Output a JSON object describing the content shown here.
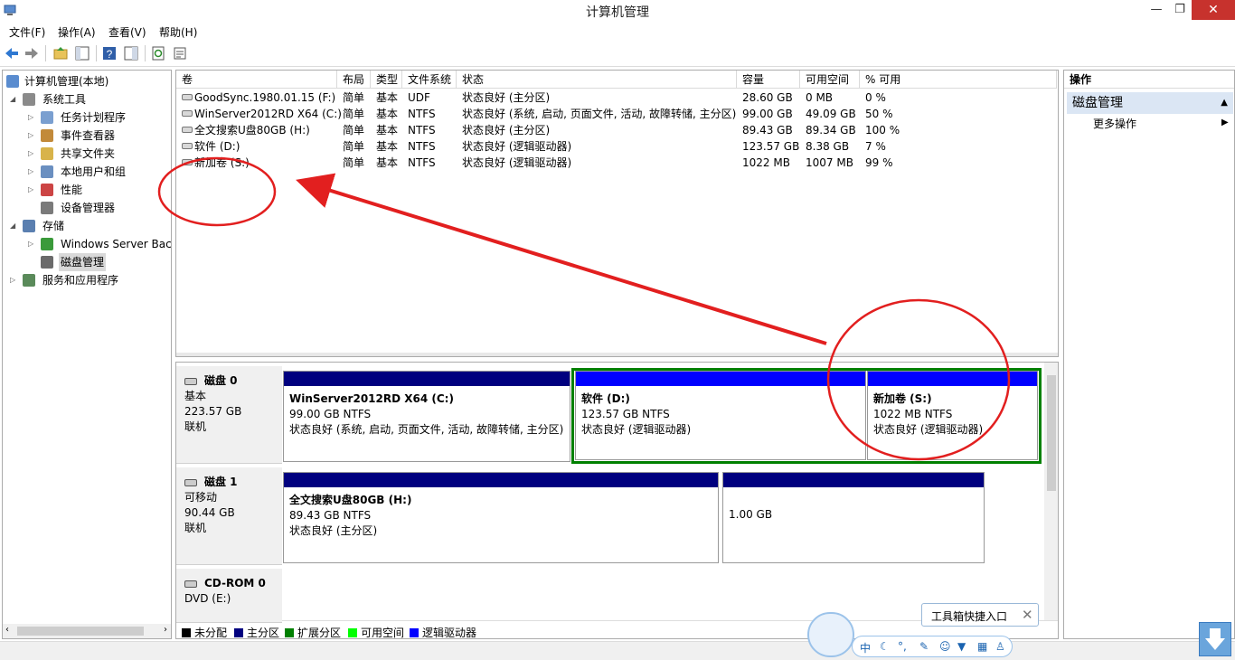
{
  "window": {
    "title": "计算机管理"
  },
  "menu": [
    "文件(F)",
    "操作(A)",
    "查看(V)",
    "帮助(H)"
  ],
  "toolbar_icons": [
    "back-arrow-icon",
    "forward-arrow-icon",
    "up-folder-icon",
    "show-hide-tree-icon",
    "help-icon",
    "properties-icon",
    "refresh-icon",
    "export-icon"
  ],
  "tree": {
    "items": [
      {
        "label": "计算机管理(本地)",
        "level": 0,
        "expander": "",
        "icon": "computer-management-icon"
      },
      {
        "label": "系统工具",
        "level": 1,
        "expander": "◢",
        "icon": "tools-icon"
      },
      {
        "label": "任务计划程序",
        "level": 2,
        "expander": "▷",
        "icon": "clock-icon"
      },
      {
        "label": "事件查看器",
        "level": 2,
        "expander": "▷",
        "icon": "event-viewer-icon"
      },
      {
        "label": "共享文件夹",
        "level": 2,
        "expander": "▷",
        "icon": "shared-folder-icon"
      },
      {
        "label": "本地用户和组",
        "level": 2,
        "expander": "▷",
        "icon": "users-icon"
      },
      {
        "label": "性能",
        "level": 2,
        "expander": "▷",
        "icon": "performance-icon"
      },
      {
        "label": "设备管理器",
        "level": 2,
        "expander": "",
        "icon": "device-manager-icon"
      },
      {
        "label": "存储",
        "level": 1,
        "expander": "◢",
        "icon": "storage-icon"
      },
      {
        "label": "Windows Server Back",
        "level": 2,
        "expander": "▷",
        "icon": "backup-icon"
      },
      {
        "label": "磁盘管理",
        "level": 2,
        "expander": "",
        "icon": "disk-management-icon",
        "selected": true
      },
      {
        "label": "服务和应用程序",
        "level": 1,
        "expander": "▷",
        "icon": "services-icon"
      }
    ]
  },
  "volume_table": {
    "columns": [
      "卷",
      "布局",
      "类型",
      "文件系统",
      "状态",
      "容量",
      "可用空间",
      "% 可用"
    ],
    "rows": [
      [
        "GoodSync.1980.01.15 (F:)",
        "简单",
        "基本",
        "UDF",
        "状态良好 (主分区)",
        "28.60 GB",
        "0 MB",
        "0 %"
      ],
      [
        "WinServer2012RD X64 (C:)",
        "简单",
        "基本",
        "NTFS",
        "状态良好 (系统, 启动, 页面文件, 活动, 故障转储, 主分区)",
        "99.00 GB",
        "49.09 GB",
        "50 %"
      ],
      [
        "全文搜索U盘80GB (H:)",
        "简单",
        "基本",
        "NTFS",
        "状态良好 (主分区)",
        "89.43 GB",
        "89.34 GB",
        "100 %"
      ],
      [
        "软件 (D:)",
        "简单",
        "基本",
        "NTFS",
        "状态良好 (逻辑驱动器)",
        "123.57 GB",
        "8.38 GB",
        "7 %"
      ],
      [
        "新加卷 (S:)",
        "简单",
        "基本",
        "NTFS",
        "状态良好 (逻辑驱动器)",
        "1022 MB",
        "1007 MB",
        "99 %"
      ]
    ]
  },
  "disks": [
    {
      "name": "磁盘 0",
      "type": "基本",
      "size": "223.57 GB",
      "status": "联机",
      "partitions": [
        {
          "name": "WinServer2012RD X64  (C:)",
          "size": "99.00 GB NTFS",
          "status": "状态良好 (系统, 启动, 页面文件, 活动, 故障转储, 主分区)"
        },
        {
          "name": "软件  (D:)",
          "size": "123.57 GB NTFS",
          "status": "状态良好 (逻辑驱动器)"
        },
        {
          "name": "新加卷  (S:)",
          "size": "1022 MB NTFS",
          "status": "状态良好 (逻辑驱动器)"
        }
      ]
    },
    {
      "name": "磁盘 1",
      "type": "可移动",
      "size": "90.44 GB",
      "status": "联机",
      "partitions": [
        {
          "name": "全文搜索U盘80GB  (H:)",
          "size": "89.43 GB NTFS",
          "status": "状态良好 (主分区)"
        },
        {
          "name": "",
          "size": "1.00 GB",
          "status": ""
        }
      ]
    },
    {
      "name": "CD-ROM 0",
      "type": "DVD (E:)",
      "size": "",
      "status": ""
    }
  ],
  "legend": [
    {
      "label": "未分配",
      "color": "#000000"
    },
    {
      "label": "主分区",
      "color": "#00007f"
    },
    {
      "label": "扩展分区",
      "color": "#008000"
    },
    {
      "label": "可用空间",
      "color": "#00ff00"
    },
    {
      "label": "逻辑驱动器",
      "color": "#0000ff"
    }
  ],
  "actions": {
    "header": "操作",
    "section": "磁盘管理",
    "more": "更多操作"
  },
  "floating": {
    "toolbox_label": "工具箱快捷入口",
    "ime_mode": "中"
  },
  "colors": {
    "primary_partition": "#00007f",
    "logical_drive": "#0000ff",
    "extended_partition": "#008000",
    "annotation": "#e21f1f"
  }
}
